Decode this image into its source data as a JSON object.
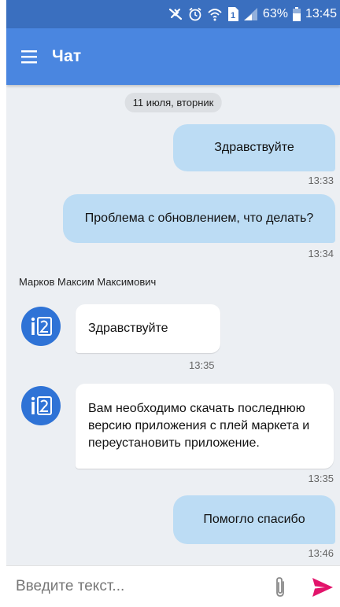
{
  "status_bar": {
    "battery_percent": "63%",
    "time": "13:45",
    "sim_label": "1",
    "icons": [
      "vibrate-icon",
      "alarm-icon",
      "wifi-icon",
      "sim-icon",
      "signal-icon",
      "battery-icon"
    ]
  },
  "app_bar": {
    "title": "Чат",
    "menu_icon": "menu-icon"
  },
  "chat": {
    "date_label": "11 июля, вторник",
    "messages": [
      {
        "direction": "out",
        "text": "Здравствуйте",
        "time": "13:33"
      },
      {
        "direction": "out",
        "text": "Проблема с обновлением, что делать?",
        "time": "13:34"
      },
      {
        "direction": "in",
        "sender": "Марков Максим Максимович",
        "text": "Здравствуйте",
        "time": "13:35"
      },
      {
        "direction": "in",
        "text": "Вам необходимо скачать последнюю версию приложения с плей маркета и переустановить приложение.",
        "time": "13:35"
      },
      {
        "direction": "out",
        "text": "Помогло спасибо",
        "time": "13:46"
      }
    ]
  },
  "input": {
    "placeholder": "Введите текст...",
    "attach_icon": "paperclip-icon",
    "send_icon": "send-icon"
  },
  "colors": {
    "status_bar": "#3a6fbf",
    "app_bar": "#4a86e0",
    "chat_background": "#eceff3",
    "outgoing_bubble": "#bcdcf4",
    "incoming_bubble": "#ffffff",
    "avatar": "#2f73d6",
    "send_icon": "#e2146b"
  }
}
